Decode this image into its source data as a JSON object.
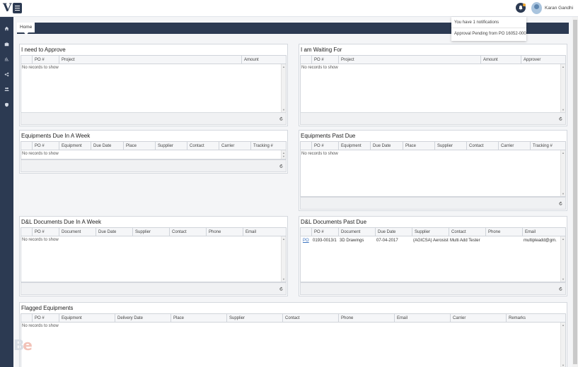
{
  "header": {
    "user_name": "Karan Gandhi"
  },
  "nav": {
    "home_tab": "Home"
  },
  "notifications": {
    "summary": "You have 1 notifications",
    "item": "Approval Pending from PO 16052-000..."
  },
  "sidebar": {
    "icons": [
      "home-icon",
      "briefcase-icon",
      "bar-chart-icon",
      "share-icon",
      "users-icon",
      "shield-icon"
    ]
  },
  "panels": {
    "need_approve": {
      "title": "I need to Approve",
      "columns": [
        "PO #",
        "Project",
        "Amount"
      ],
      "empty": "No records to show"
    },
    "waiting_for": {
      "title": "I am Waiting For",
      "columns": [
        "PO #",
        "Project",
        "Amount",
        "Approver"
      ],
      "empty": "No records to show"
    },
    "equip_due": {
      "title": "Equipments Due In A Week",
      "columns": [
        "PO #",
        "Equipment",
        "Due Date",
        "Place",
        "Supplier",
        "Contact",
        "Carrier",
        "Tracking #"
      ],
      "empty": "No records to show"
    },
    "equip_past": {
      "title": "Equipments Past Due",
      "columns": [
        "PO #",
        "Equipment",
        "Due Date",
        "Place",
        "Supplier",
        "Contact",
        "Carrier",
        "Tracking #"
      ],
      "empty": "No records to show"
    },
    "dl_due": {
      "title": "D&L Documents Due In A Week",
      "columns": [
        "PO #",
        "Document",
        "Due Date",
        "Supplier",
        "Contact",
        "Phone",
        "Email"
      ],
      "empty": "No records to show"
    },
    "dl_past": {
      "title": "D&L Documents Past Due",
      "columns": [
        "PO #",
        "Document",
        "Due Date",
        "Supplier",
        "Contact",
        "Phone",
        "Email"
      ],
      "row": {
        "link": "PO",
        "po": "0193-0013/1",
        "document": "3D Drawings",
        "due_date": "07-04-2017",
        "supplier": "(AGICSA) Aerosiste...",
        "contact": "Multi Add Tester",
        "phone": "",
        "email": "multipleadd@gm..."
      }
    },
    "flagged": {
      "title": "Flagged Equipments",
      "columns": [
        "PO #",
        "Equipment",
        "Delivery Date",
        "Place",
        "Supplier",
        "Contact",
        "Phone",
        "Email",
        "Carrier",
        "Remarks"
      ],
      "empty": "No records to show"
    }
  },
  "brand": {
    "left": "B",
    "right": "e"
  }
}
